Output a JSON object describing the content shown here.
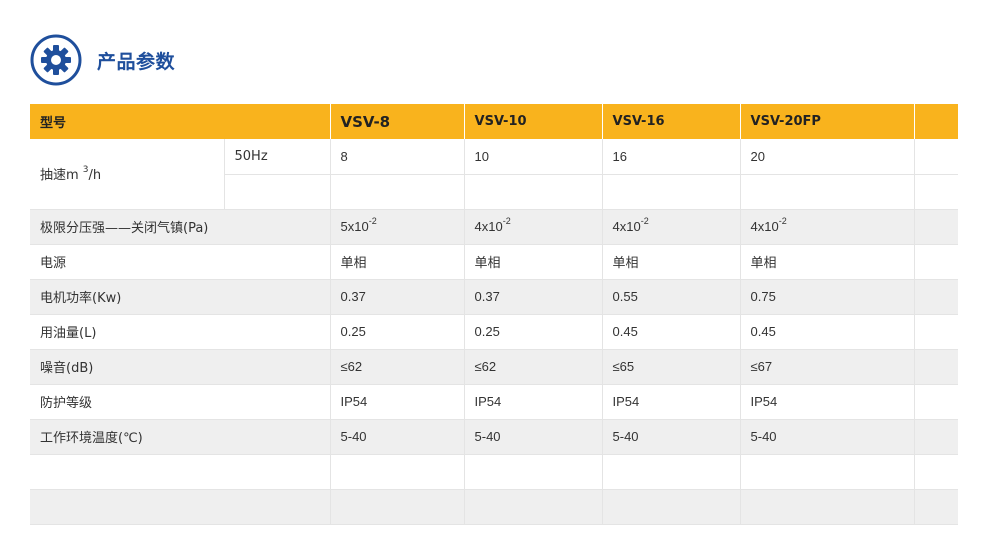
{
  "section": {
    "title": "产品参数",
    "icon": "gear-icon",
    "icon_color": "#1f4f9c"
  },
  "colors": {
    "header_bg": "#f9b31d",
    "alt_row_bg": "#efefef",
    "title_color": "#1f4f9c"
  },
  "table": {
    "header": {
      "label": "型号",
      "models": [
        "VSV-8",
        "VSV-10",
        "VSV-16",
        "VSV-20FP"
      ]
    },
    "speed": {
      "label_prefix": "抽速m ",
      "label_sup": "3",
      "label_suffix": "/h",
      "freq": "50Hz",
      "values": [
        "8",
        "10",
        "16",
        "20"
      ]
    },
    "pressure": {
      "label": "极限分压强——关闭气镇(Pa)",
      "values": [
        {
          "base": "5x10",
          "exp": "-2"
        },
        {
          "base": "4x10",
          "exp": "-2"
        },
        {
          "base": "4x10",
          "exp": "-2"
        },
        {
          "base": "4x10",
          "exp": "-2"
        }
      ]
    },
    "rows": [
      {
        "key": "power-supply",
        "label": "电源",
        "values": [
          "单相",
          "单相",
          "单相",
          "单相"
        ]
      },
      {
        "key": "motor-power",
        "label": "电机功率(Kw)",
        "values": [
          "0.37",
          "0.37",
          "0.55",
          "0.75"
        ]
      },
      {
        "key": "oil-volume",
        "label": "用油量(L)",
        "values": [
          "0.25",
          "0.25",
          "0.45",
          "0.45"
        ]
      },
      {
        "key": "noise",
        "label": "噪音(dB)",
        "values": [
          "≤62",
          "≤62",
          "≤65",
          "≤67"
        ]
      },
      {
        "key": "protection",
        "label": "防护等级",
        "values": [
          "IP54",
          "IP54",
          "IP54",
          "IP54"
        ]
      },
      {
        "key": "temperature",
        "label": "工作环境温度(℃)",
        "values": [
          "5-40",
          "5-40",
          "5-40",
          "5-40"
        ]
      }
    ]
  }
}
